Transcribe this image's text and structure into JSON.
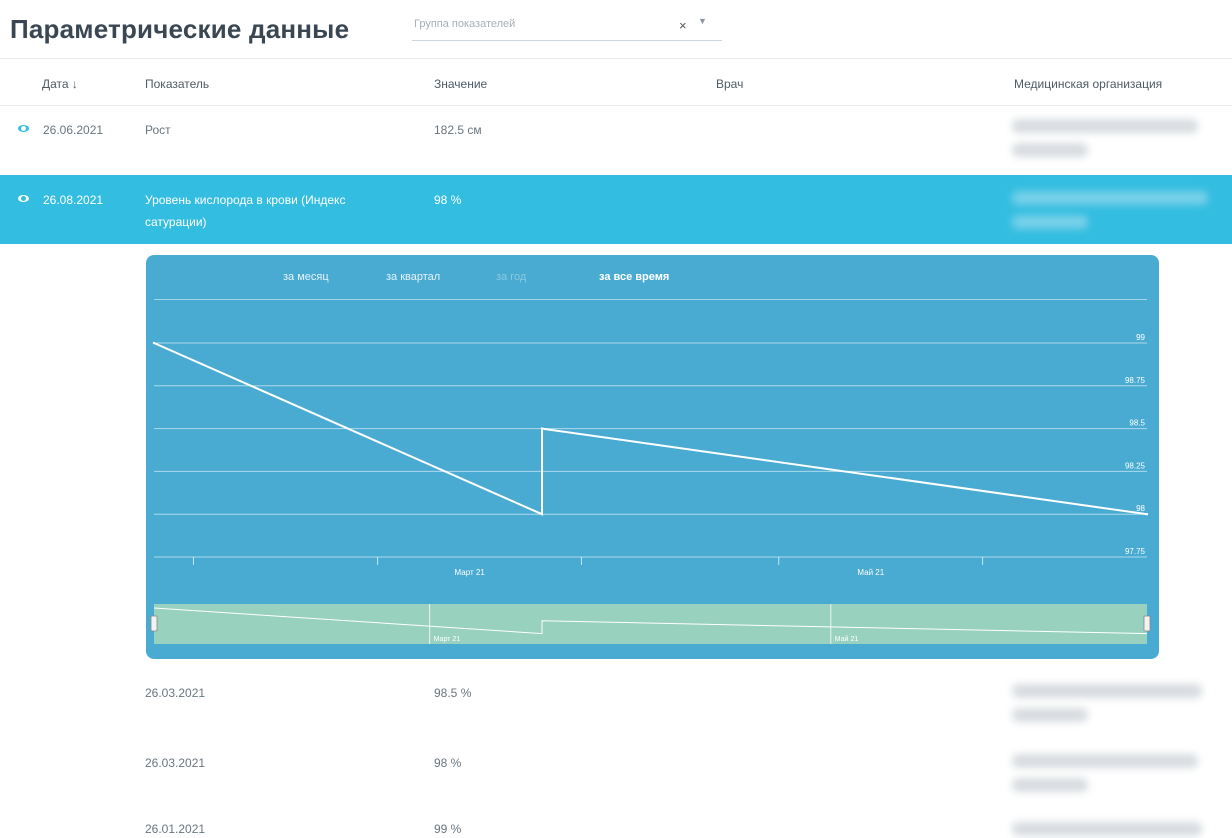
{
  "page": {
    "title": "Параметрические данные"
  },
  "filter": {
    "placeholder": "Группа показателей",
    "clear": "×",
    "caret": "▼"
  },
  "table": {
    "headers": {
      "date": "Дата ↓",
      "indicator": "Показатель",
      "value": "Значение",
      "doctor": "Врач",
      "org": "Медицинская организация"
    },
    "rows": [
      {
        "date": "26.06.2021",
        "indicator": "Рост",
        "value": "182.5 см"
      },
      {
        "date": "26.08.2021",
        "indicator_line1": "Уровень кислорода в крови (Индекс",
        "indicator_line2": "сатурации)",
        "value": "98 %"
      }
    ],
    "subrows": [
      {
        "date": "26.03.2021",
        "value": "98.5 %"
      },
      {
        "date": "26.03.2021",
        "value": "98 %"
      },
      {
        "date": "26.01.2021",
        "value": "99 %"
      }
    ]
  },
  "chart": {
    "tabs": [
      "за месяц",
      "за квартал",
      "за год",
      "за все время"
    ],
    "active_tab": "за все время"
  },
  "chart_data": {
    "type": "line",
    "x": [
      "2021-01-26",
      "2021-03-26",
      "2021-03-26",
      "2021-06-26"
    ],
    "y": [
      99,
      98,
      98.5,
      98
    ],
    "ylim": [
      97.75,
      99
    ],
    "yticks": [
      "99",
      "98.75",
      "98.5",
      "98.25",
      "98",
      "97.75"
    ],
    "xtick_labels": [
      "Март 21",
      "Май 21"
    ],
    "navigator_labels": [
      "Март 21",
      "Май 21"
    ],
    "colors": {
      "line": "#ffffff",
      "background": "#49abd2",
      "navigator": "#9dd3bd"
    }
  }
}
